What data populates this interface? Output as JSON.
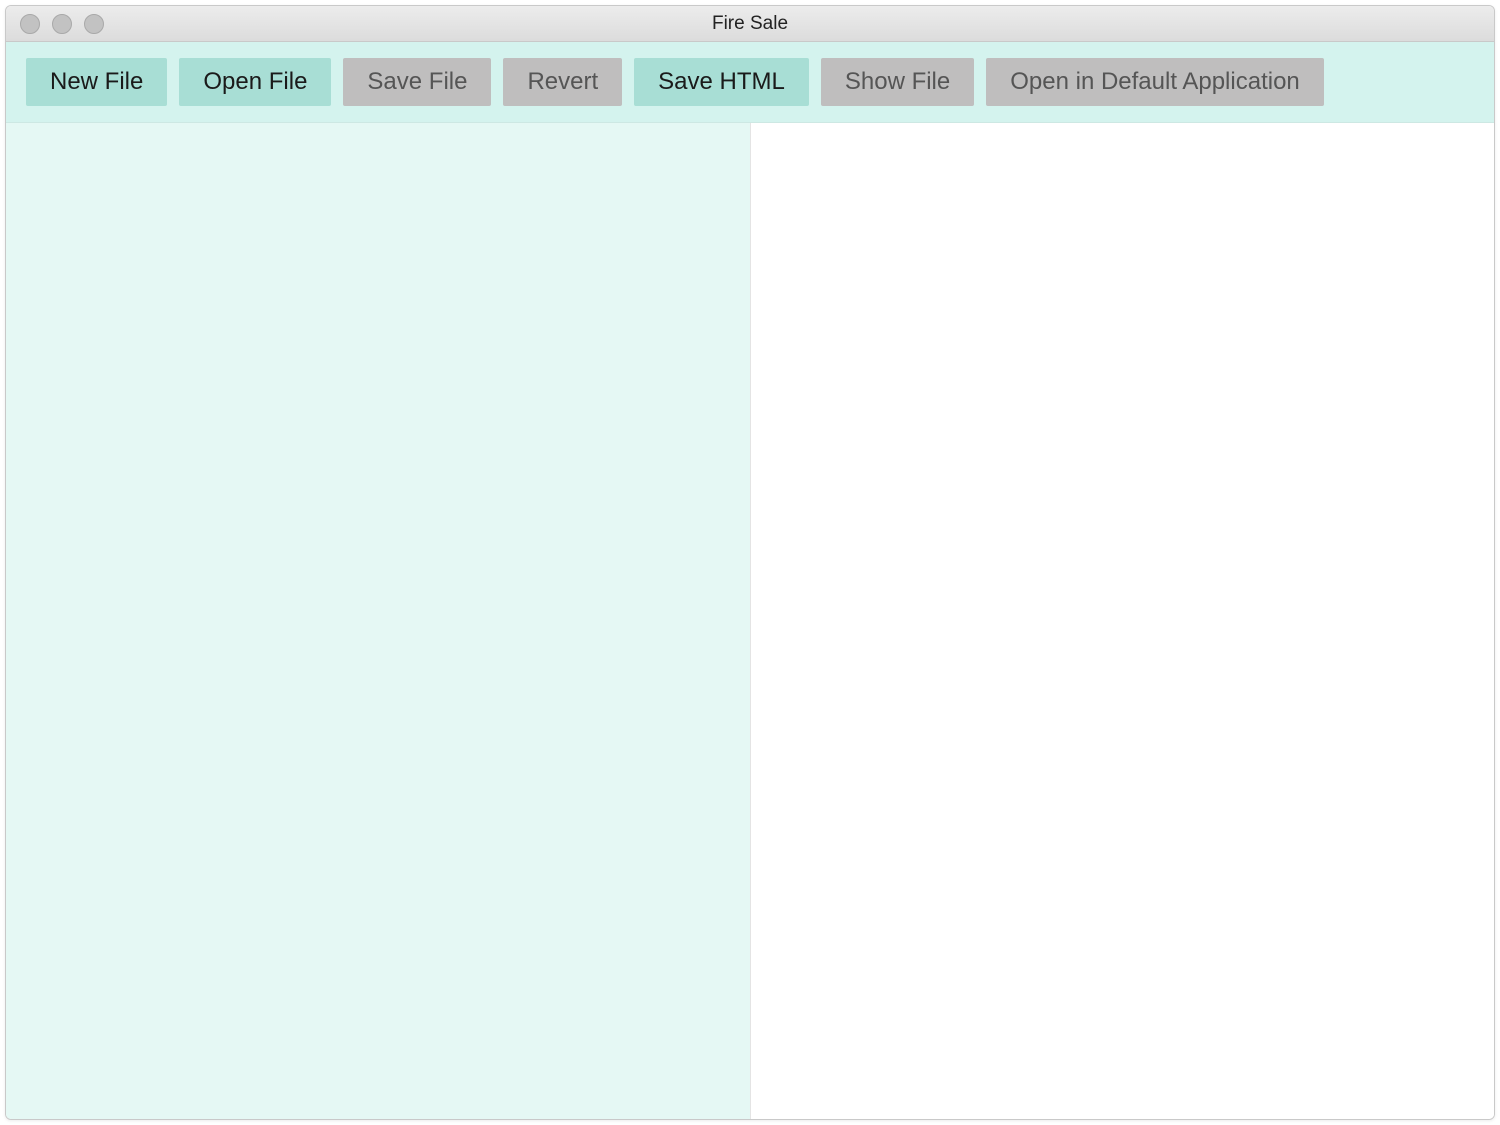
{
  "window": {
    "title": "Fire Sale"
  },
  "toolbar": {
    "buttons": [
      {
        "label": "New File",
        "enabled": true
      },
      {
        "label": "Open File",
        "enabled": true
      },
      {
        "label": "Save File",
        "enabled": false
      },
      {
        "label": "Revert",
        "enabled": false
      },
      {
        "label": "Save HTML",
        "enabled": true
      },
      {
        "label": "Show File",
        "enabled": false
      },
      {
        "label": "Open in Default Application",
        "enabled": false
      }
    ]
  },
  "content": {
    "editor_text": "",
    "preview_html": ""
  },
  "colors": {
    "toolbar_bg": "#d4f3ee",
    "btn_enabled_bg": "#a8ded5",
    "btn_disabled_bg": "#bfbebe",
    "editor_bg": "#e5f8f4",
    "preview_bg": "#ffffff"
  }
}
